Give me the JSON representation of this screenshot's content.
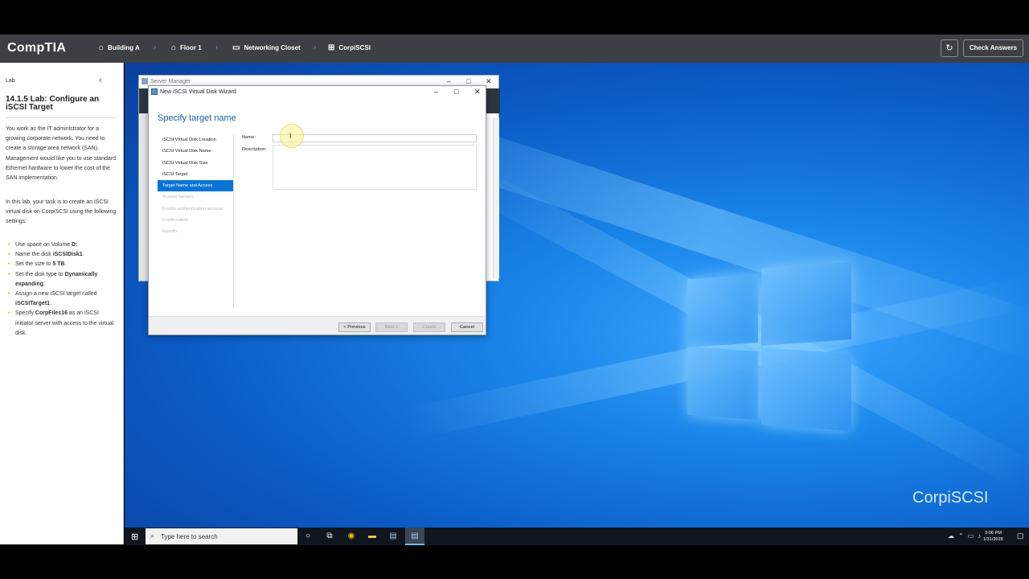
{
  "topbar": {
    "logo": "CompTIA",
    "breadcrumbs": [
      {
        "label": "Building A",
        "icon": "building-icon"
      },
      {
        "label": "Floor 1",
        "icon": "floor-icon"
      },
      {
        "label": "Networking Closet",
        "icon": "monitor-icon"
      },
      {
        "label": "CorpiSCSI",
        "icon": "windows-icon"
      }
    ],
    "check_answers": "Check Answers"
  },
  "sidebar": {
    "section_label": "Lab",
    "title": "14.1.5 Lab: Configure an iSCSI Target",
    "intro": "You work as the IT administrator for a growing corporate network. You need to create a storage area network (SAN). Management would like you to use standard Ethernet hardware to lower the cost of the SAN implementation.",
    "task": "In this lab, your task is to create an iSCSI virtual disk on CorpiSCSI using the following settings:",
    "tasks": [
      {
        "pre": "Use space on Volume ",
        "bold": "D:",
        "post": ""
      },
      {
        "pre": "Name the disk ",
        "bold": "iSCSIDisk1",
        "post": "."
      },
      {
        "pre": "Set the size to ",
        "bold": "5 TB",
        "post": "."
      },
      {
        "pre": "Set the disk type to ",
        "bold": "Dynamically expanding",
        "post": "."
      },
      {
        "pre": "Assign a new iSCSI target called ",
        "bold": "iSCSITarget1",
        "post": "."
      },
      {
        "pre": "Specify ",
        "bold": "CorpFiles16",
        "post": " as an iSCSI initiator server with access to the virtual disk."
      }
    ]
  },
  "server_manager": {
    "title": "Server Manager"
  },
  "wizard": {
    "title": "New iSCSI Virtual Disk Wizard",
    "heading": "Specify target name",
    "steps": [
      {
        "label": "iSCSI Virtual Disk Location",
        "state": "done"
      },
      {
        "label": "iSCSI Virtual Disk Name",
        "state": "done"
      },
      {
        "label": "iSCSI Virtual Disk Size",
        "state": "done"
      },
      {
        "label": "iSCSI Target",
        "state": "done"
      },
      {
        "label": "Target Name and Access",
        "state": "active"
      },
      {
        "label": "Access Servers",
        "state": "disabled"
      },
      {
        "label": "Enable authentication services",
        "state": "disabled"
      },
      {
        "label": "Confirmation",
        "state": "disabled"
      },
      {
        "label": "Results",
        "state": "disabled"
      }
    ],
    "name_label": "Name:",
    "name_value": "",
    "description_label": "Description:",
    "description_value": "",
    "buttons": {
      "previous": "< Previous",
      "next": "Next >",
      "create": "Create",
      "cancel": "Cancel"
    }
  },
  "desktop": {
    "watermark": "CorpiSCSI"
  },
  "taskbar": {
    "search_placeholder": "Type here to search",
    "time": "3:06 PM",
    "date": "1/31/2026"
  }
}
